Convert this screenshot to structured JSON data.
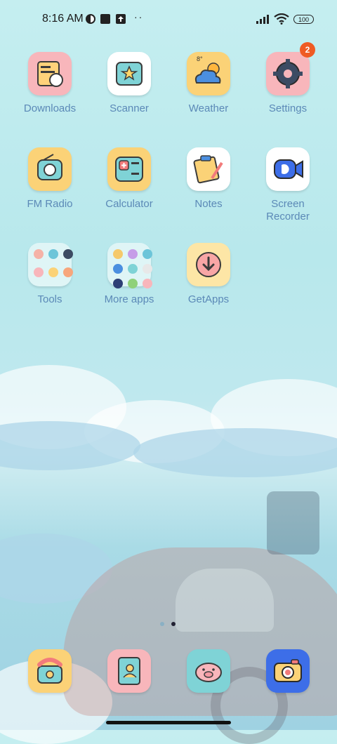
{
  "status_bar": {
    "time": "8:16 AM",
    "battery": "100",
    "overflow": "··"
  },
  "apps": [
    {
      "label": "Downloads"
    },
    {
      "label": "Scanner"
    },
    {
      "label": "Weather",
      "temperature": "8°"
    },
    {
      "label": "Settings",
      "badge": "2"
    },
    {
      "label": "FM Radio"
    },
    {
      "label": "Calculator"
    },
    {
      "label": "Notes"
    },
    {
      "label": "Screen Recorder"
    },
    {
      "label": "Tools"
    },
    {
      "label": "More apps"
    },
    {
      "label": "GetApps"
    }
  ],
  "dock": [
    "phone-icon",
    "contacts-icon",
    "messaging-icon",
    "camera-icon"
  ],
  "page_indicator": {
    "pages": 2,
    "current": 2
  },
  "colors": {
    "label": "#5b89b7",
    "badge": "#ef5b24"
  }
}
